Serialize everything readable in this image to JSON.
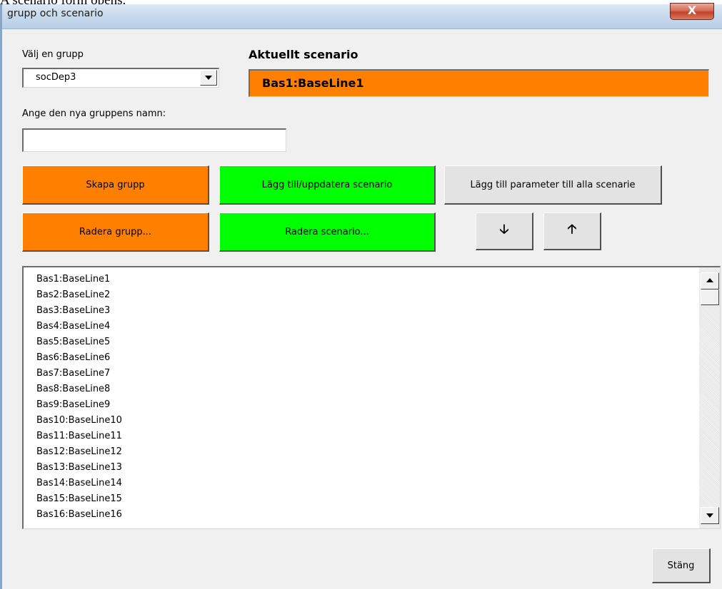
{
  "page_caption": "A scenario form opens.",
  "window": {
    "title": "grupp och scenario",
    "close_glyph": "X"
  },
  "group_select": {
    "label": "Välj en grupp",
    "value": "socDep3",
    "arrow_icon": "chevron-down-icon"
  },
  "current_scenario": {
    "label": "Aktuellt scenario",
    "value": "Bas1:BaseLine1",
    "color": "#ff8000"
  },
  "new_group": {
    "label": "Ange den nya gruppens namn:",
    "value": "",
    "placeholder": ""
  },
  "buttons": {
    "create_group": "Skapa grupp",
    "add_update_scenario": "Lägg till/uppdatera scenario",
    "add_parameter": "Lägg till parameter till alla scenarie",
    "delete_group": "Radera grupp...",
    "delete_scenario": "Radera scenario...",
    "move_down": "🡣",
    "move_up": "🡡",
    "close": "Stäng"
  },
  "colors": {
    "orange": "#ff8000",
    "green": "#00ff00",
    "gray_button": "#e3e3e3",
    "dialog_bg": "#f0f0f0"
  },
  "scenario_list": {
    "items": [
      "Bas1:BaseLine1",
      "Bas2:BaseLine2",
      "Bas3:BaseLine3",
      "Bas4:BaseLine4",
      "Bas5:BaseLine5",
      "Bas6:BaseLine6",
      "Bas7:BaseLine7",
      "Bas8:BaseLine8",
      "Bas9:BaseLine9",
      "Bas10:BaseLine10",
      "Bas11:BaseLine11",
      "Bas12:BaseLine12",
      "Bas13:BaseLine13",
      "Bas14:BaseLine14",
      "Bas15:BaseLine15",
      "Bas16:BaseLine16"
    ]
  }
}
